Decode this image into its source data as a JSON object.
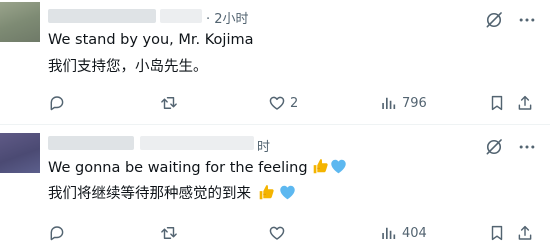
{
  "tweets": [
    {
      "time": "· 2小时",
      "text_en": "We stand by you, Mr. Kojima",
      "text_zh": "我们支持您，小岛先生。",
      "likes": "2",
      "views": "796"
    },
    {
      "time": "时",
      "text_en": "We gonna be waiting for the feeling",
      "text_zh": "我们将继续等待那种感觉的到来",
      "views": "404"
    }
  ],
  "icons": {
    "grok": "grok-icon",
    "more": "more-icon",
    "reply": "reply-icon",
    "retweet": "retweet-icon",
    "like": "heart-icon",
    "views": "views-icon",
    "bookmark": "bookmark-icon",
    "share": "share-icon",
    "thumbs": "thumbs-up-emoji",
    "heart_blue": "blue-heart-emoji"
  },
  "colors": {
    "text": "#0f1419",
    "muted": "#536471",
    "divider": "#eff3f4",
    "emoji_thumb": "#f4b400",
    "emoji_heart": "#5db8f0"
  }
}
